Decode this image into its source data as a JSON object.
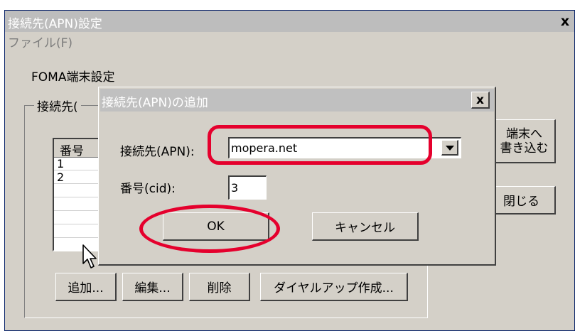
{
  "main_window": {
    "title": "接続先(APN)設定",
    "close_label": "x",
    "menu_file": "ファイル(F)",
    "section_label": "FOMA端末設定",
    "group_label": "接続先(",
    "list_header": "番号",
    "list_rows": [
      "1",
      "2"
    ],
    "write_button_line1": "端末へ",
    "write_button_line2": "書き込む",
    "close_button_label": "閉じる",
    "add_button_label": "追加...",
    "edit_button_label": "編集...",
    "delete_button_label": "削除",
    "dialup_button_label": "ダイヤルアップ作成..."
  },
  "dialog": {
    "title": "接続先(APN)の追加",
    "close_label": "x",
    "apn_label": "接続先(APN):",
    "apn_value": "mopera.net",
    "cid_label": "番号(cid):",
    "cid_value": "3",
    "ok_label": "OK",
    "cancel_label": "キャンセル"
  },
  "colors": {
    "highlight": "#e5002d",
    "window_face": "#d4d0c8",
    "inactive_title": "#bdbdbd"
  }
}
